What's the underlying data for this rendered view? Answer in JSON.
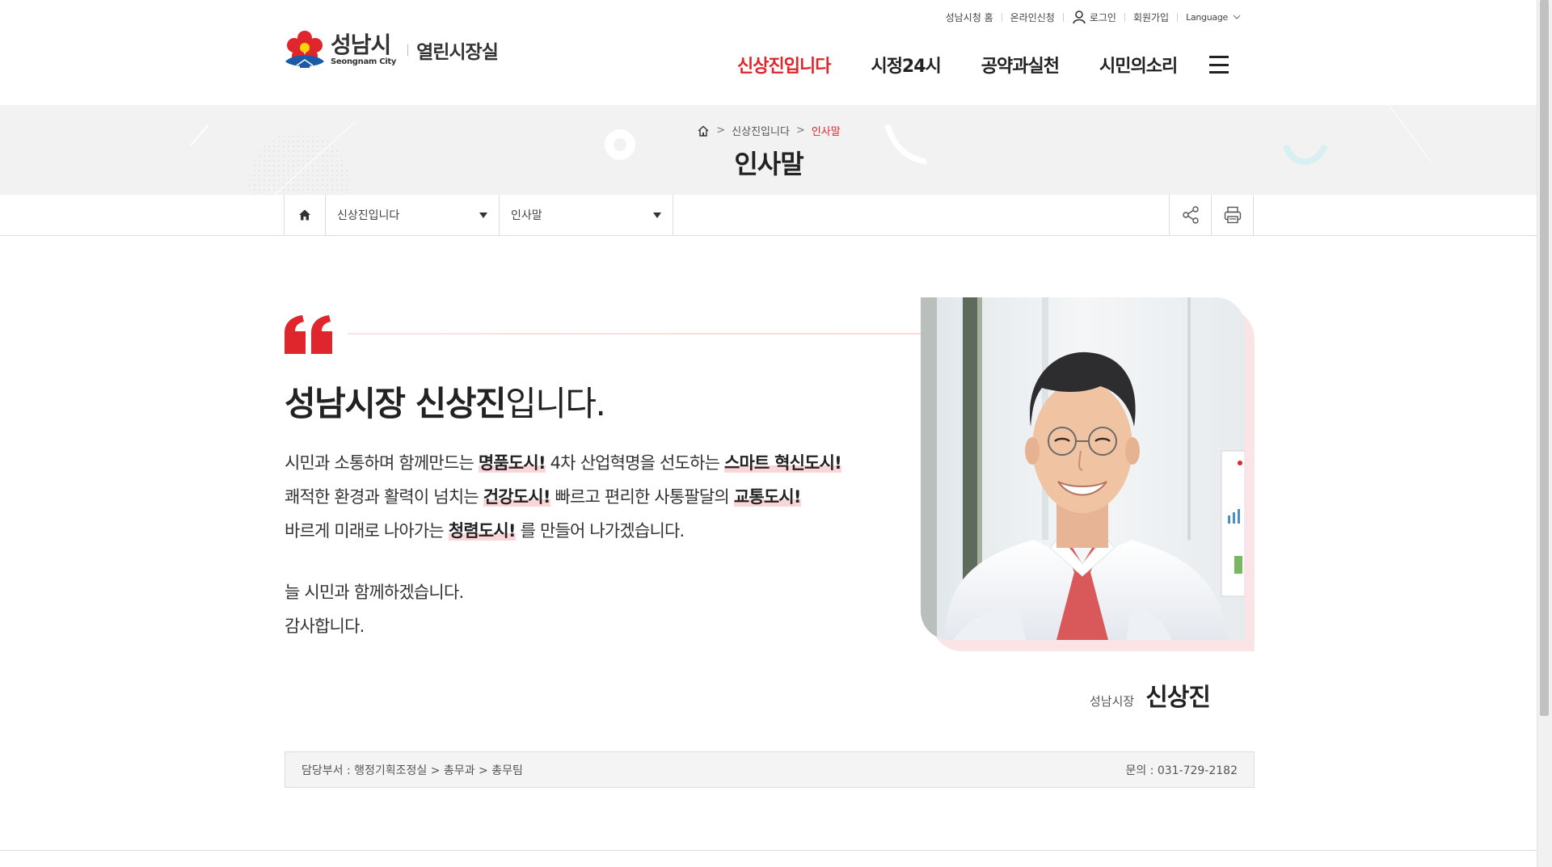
{
  "header": {
    "util": {
      "home": "성남시청 홈",
      "online": "온라인신청",
      "login": "로그인",
      "join": "회원가입",
      "language": "Language"
    },
    "logo": {
      "kor": "성남시",
      "eng": "Seongnam City",
      "sub": "열린시장실"
    },
    "nav": [
      "신상진입니다",
      "시정24시",
      "공약과실천",
      "시민의소리"
    ]
  },
  "breadcrumb": {
    "items": [
      "신상진입니다",
      "인사말"
    ],
    "separator": ">"
  },
  "page_title": "인사말",
  "location": {
    "depth1": "신상진입니다",
    "depth2": "인사말"
  },
  "greeting": {
    "title_bold": "성남시장 신상진",
    "title_rest": "입니다.",
    "lines": [
      {
        "a": "시민과 소통하며 함께만드는 ",
        "b": "명품도시!",
        "c": " 4차 산업혁명을 선도하는 ",
        "d": "스마트 혁신도시!"
      },
      {
        "a": "쾌적한 환경과 활력이 넘치는 ",
        "b": "건강도시!",
        "c": " 빠르고 편리한 사통팔달의 ",
        "d": "교통도시!"
      },
      {
        "a": "바르게 미래로 나아가는 ",
        "b": "청렴도시!",
        "c": " 를 만들어 나가겠습니다.",
        "d": ""
      }
    ],
    "closing": [
      "늘 시민과 함께하겠습니다.",
      "감사합니다."
    ]
  },
  "signature": {
    "role": "성남시장",
    "name": "신상진"
  },
  "dept": {
    "label": "담당부서 : 행정기획조정실 > 총무과 > 총무팀",
    "contact": "문의 : 031-729-2182"
  },
  "colors": {
    "accent": "#e0262d",
    "highlight": "#fad6d8"
  }
}
